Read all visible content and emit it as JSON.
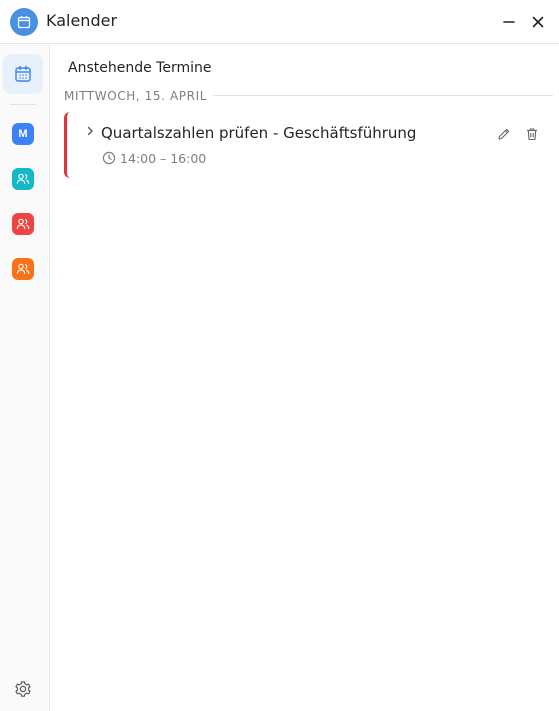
{
  "window": {
    "title": "Kalender",
    "icon": "calendar-icon",
    "controls": [
      "minimize-icon",
      "close-icon"
    ]
  },
  "sidebar": {
    "items": [
      {
        "name": "calendar-view",
        "icon": "calendar-icon",
        "active": true
      },
      {
        "name": "calendar-m",
        "label": "M",
        "color": "#3b82f6"
      },
      {
        "name": "calendar-group-teal",
        "icon": "users-icon",
        "color": "#14b8c9"
      },
      {
        "name": "calendar-group-red",
        "icon": "users-icon",
        "color": "#ef4444"
      },
      {
        "name": "calendar-group-orange",
        "icon": "users-icon",
        "color": "#f97316"
      }
    ],
    "settings_icon": "gear-icon"
  },
  "main": {
    "section_title": "Anstehende Termine",
    "date_header": "MITTWOCH, 15. APRIL",
    "events": [
      {
        "title": "Quartalszahlen prüfen - Geschäftsführung",
        "time": "14:00 – 16:00",
        "accent_color": "#e2333a"
      }
    ]
  },
  "colors": {
    "accent": "#4a90e2",
    "event_red": "#e2333a",
    "muted_text": "#7a7f86"
  }
}
